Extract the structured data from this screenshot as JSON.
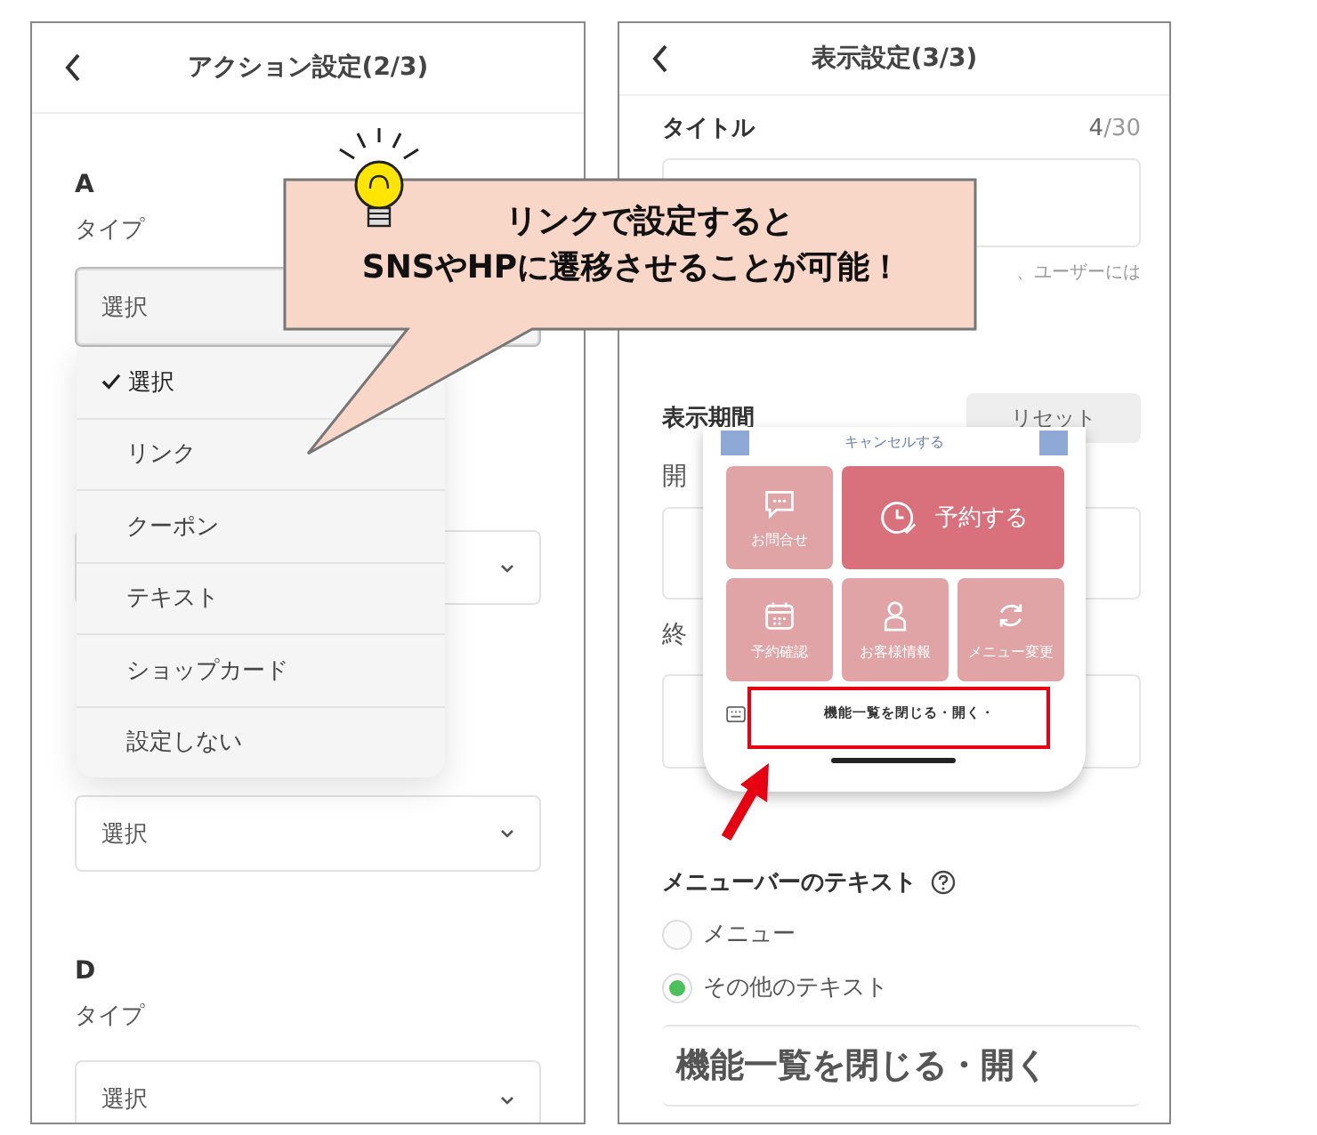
{
  "left_screen": {
    "title": "アクション設定(2/3)",
    "section_a": {
      "heading": "A",
      "label": "タイプ",
      "select": {
        "value": "選択",
        "focused": true
      }
    },
    "dropdown": {
      "options": [
        {
          "label": "選択",
          "selected": true
        },
        {
          "label": "リンク",
          "selected": false
        },
        {
          "label": "クーポン",
          "selected": false
        },
        {
          "label": "テキスト",
          "selected": false
        },
        {
          "label": "ショップカード",
          "selected": false
        },
        {
          "label": "設定しない",
          "selected": false
        }
      ]
    },
    "section_c": {
      "select": {
        "value": "選択",
        "focused": false
      }
    },
    "section_d": {
      "heading": "D",
      "label": "タイプ",
      "select": {
        "value": "選択",
        "focused": false
      }
    }
  },
  "right_screen": {
    "title": "表示設定(3/3)",
    "title_field": {
      "label": "タイトル",
      "counter": "**4**/30",
      "helper": "、ユーザーには"
    },
    "period": {
      "label": "表示期間",
      "reset": "リセット",
      "start_label": "開",
      "end_label": "終"
    },
    "menu_text": {
      "label": "メニューバーのテキスト",
      "options": [
        {
          "label": "メニュー",
          "selected": false
        },
        {
          "label": "その他のテキスト",
          "selected": true
        }
      ],
      "value": "機能一覧を閉じる・開く"
    }
  },
  "phone_preview": {
    "cancel": "キャンセルする",
    "tiles": [
      {
        "label": "お問合せ",
        "kind": "chat",
        "wide": false
      },
      {
        "label": "予約する",
        "kind": "clock",
        "wide": true
      },
      {
        "label": "予約確認",
        "kind": "calendar",
        "wide": false
      },
      {
        "label": "お客様情報",
        "kind": "person",
        "wide": false
      },
      {
        "label": "メニュー変更",
        "kind": "refresh",
        "wide": false
      }
    ],
    "toggle": "機能一覧を閉じる・開く・"
  },
  "callout": {
    "lines": [
      "リンクで設定すると",
      "SNSやHPに遷移させることが可能！"
    ]
  }
}
